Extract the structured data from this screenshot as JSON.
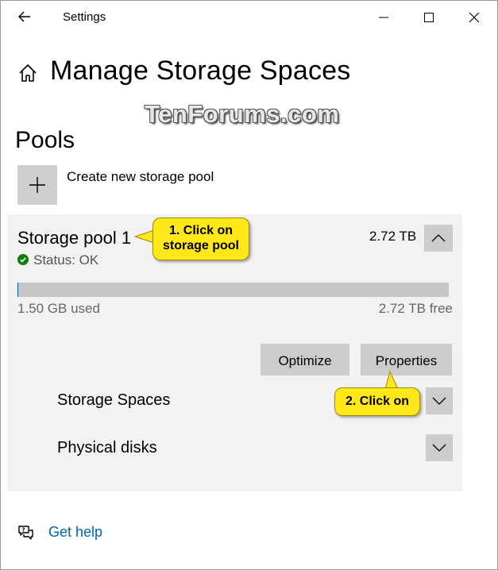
{
  "window": {
    "title": "Settings"
  },
  "page": {
    "title": "Manage Storage Spaces"
  },
  "watermark": "TenForums.com",
  "section": {
    "title": "Pools"
  },
  "create": {
    "label": "Create new storage pool"
  },
  "pool": {
    "name": "Storage pool 1",
    "status": "Status: OK",
    "size": "2.72 TB",
    "used": "1.50 GB used",
    "free": "2.72 TB free",
    "used_fraction": 0.0005,
    "optimize_label": "Optimize",
    "properties_label": "Properties",
    "rows": [
      {
        "label": "Storage Spaces"
      },
      {
        "label": "Physical disks"
      }
    ]
  },
  "callouts": {
    "first_line1": "1. Click on",
    "first_line2": "storage pool",
    "second": "2. Click on"
  },
  "help": {
    "label": "Get help"
  },
  "colors": {
    "accent": "#0063b1",
    "callout": "#ffe81a",
    "status_ok": "#107c10"
  }
}
